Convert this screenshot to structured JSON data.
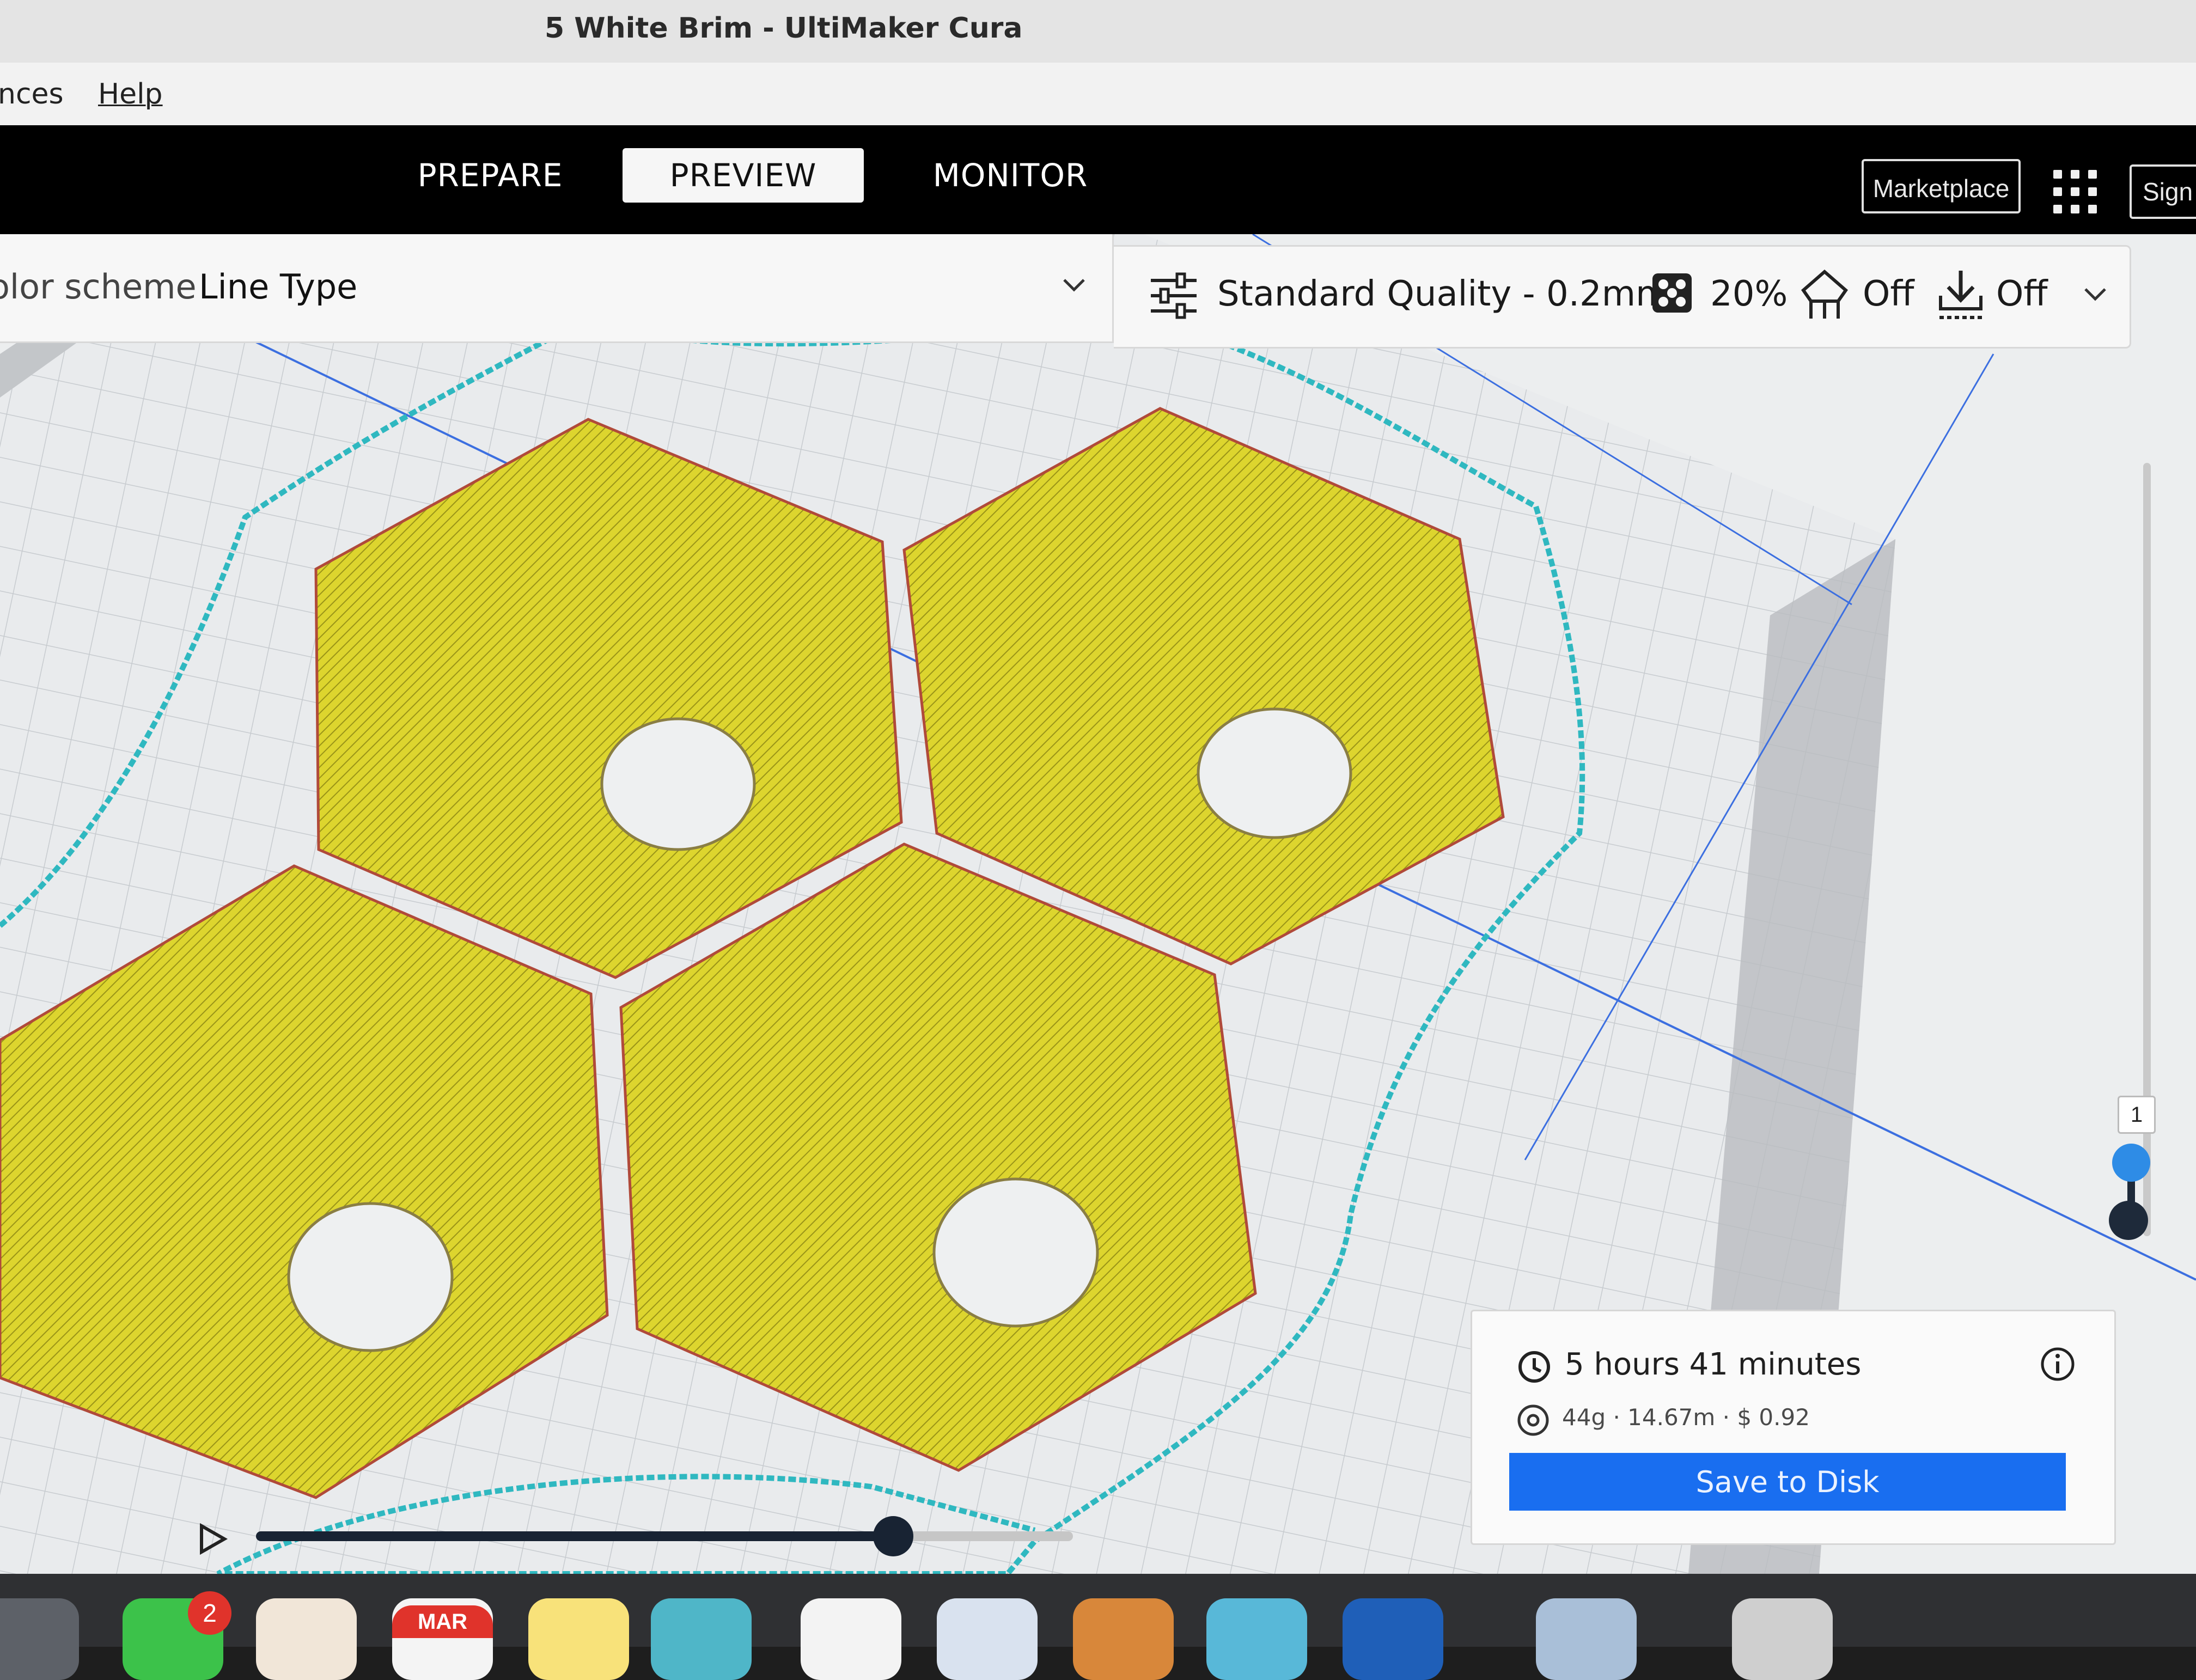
{
  "window": {
    "title": "5 White Brim - UltiMaker Cura"
  },
  "menu": {
    "items": [
      "nces",
      "Help"
    ]
  },
  "nav": {
    "tabs": [
      {
        "label": "PREPARE",
        "active": false
      },
      {
        "label": "PREVIEW",
        "active": true
      },
      {
        "label": "MONITOR",
        "active": false
      }
    ],
    "marketplace_label": "Marketplace",
    "sign_in_label": "Sign i"
  },
  "view_panel": {
    "color_scheme_label": "olor scheme",
    "color_scheme_value": "Line Type",
    "dropdown_icon": "chevron-down-icon"
  },
  "print_settings": {
    "profile": "Standard Quality - 0.2mm",
    "infill": "20%",
    "support": "Off",
    "adhesion": "Off",
    "icons": {
      "settings": "sliders-icon",
      "infill": "infill-icon",
      "support": "support-icon",
      "adhesion": "adhesion-icon",
      "expand": "chevron-down-icon"
    }
  },
  "layer_view": {
    "current_layer": "1",
    "simulation_progress": 0.78
  },
  "estimate": {
    "print_time": "5 hours 41 minutes",
    "material": "44g · 14.67m · $ 0.92",
    "save_label": "Save to Disk"
  },
  "dock": {
    "messages_badge": "2",
    "calendar_month": "MAR"
  },
  "colors": {
    "accent_blue": "#196ef0",
    "model_fill": "#d9d12b",
    "brim_outline": "#2fb8c0",
    "nav_bg": "#000000"
  }
}
